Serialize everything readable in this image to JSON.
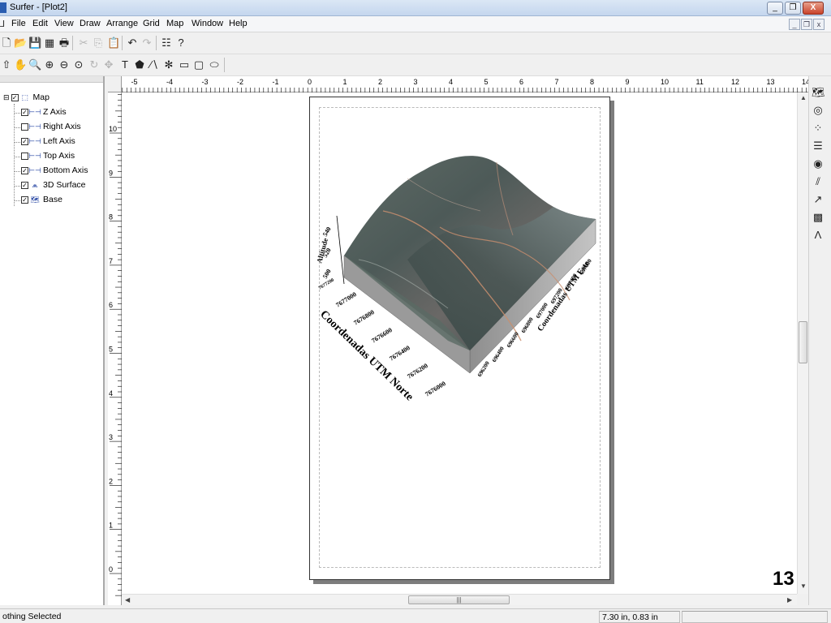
{
  "window": {
    "title": "Surfer - [Plot2]",
    "min": "_",
    "max": "❐",
    "close": "X"
  },
  "mdi_controls": {
    "min": "_",
    "restore": "❐",
    "close": "x"
  },
  "menu": [
    "File",
    "Edit",
    "View",
    "Draw",
    "Arrange",
    "Grid",
    "Map",
    "Window",
    "Help"
  ],
  "toolbar1": [
    {
      "name": "new-icon",
      "glyph": "🗋"
    },
    {
      "name": "open-icon",
      "glyph": "📂"
    },
    {
      "name": "save-icon",
      "glyph": "💾"
    },
    {
      "name": "table-icon",
      "glyph": "▦"
    },
    {
      "name": "print-icon",
      "glyph": "🖶"
    },
    {
      "name": "cut-icon",
      "glyph": "✂",
      "dim": true
    },
    {
      "name": "copy-icon",
      "glyph": "⎘",
      "dim": true
    },
    {
      "name": "paste-icon",
      "glyph": "📋"
    },
    {
      "name": "undo-icon",
      "glyph": "↶"
    },
    {
      "name": "redo-icon",
      "glyph": "↷",
      "dim": true
    },
    {
      "name": "object-manager-icon",
      "glyph": "☷"
    },
    {
      "name": "help-pointer-icon",
      "glyph": "?"
    }
  ],
  "toolbar2": [
    {
      "name": "select-arrow-icon",
      "glyph": "⇧"
    },
    {
      "name": "pan-hand-icon",
      "glyph": "✋"
    },
    {
      "name": "zoom-rect-icon",
      "glyph": "🔍"
    },
    {
      "name": "zoom-in-icon",
      "glyph": "⊕"
    },
    {
      "name": "zoom-out-icon",
      "glyph": "⊖"
    },
    {
      "name": "zoom-fit-icon",
      "glyph": "⊙"
    },
    {
      "name": "rotate-icon",
      "glyph": "↻",
      "dim": true
    },
    {
      "name": "reshape-icon",
      "glyph": "✥",
      "dim": true
    },
    {
      "name": "text-icon",
      "glyph": "T"
    },
    {
      "name": "polygon-icon",
      "glyph": "⬟"
    },
    {
      "name": "polyline-icon",
      "glyph": "∕∖"
    },
    {
      "name": "symbol-icon",
      "glyph": "✻"
    },
    {
      "name": "rectangle-icon",
      "glyph": "▭"
    },
    {
      "name": "rounded-rectangle-icon",
      "glyph": "▢"
    },
    {
      "name": "ellipse-icon",
      "glyph": "⬭"
    }
  ],
  "tree": [
    {
      "label": "Map",
      "checked": true,
      "level": 0,
      "icon": "map-frame-icon",
      "glyph": "⬚"
    },
    {
      "label": "Z Axis",
      "checked": true,
      "level": 1,
      "icon": "axis-icon",
      "glyph": "⊢⊣"
    },
    {
      "label": "Right Axis",
      "checked": false,
      "level": 1,
      "icon": "axis-icon",
      "glyph": "⊢⊣"
    },
    {
      "label": "Left Axis",
      "checked": true,
      "level": 1,
      "icon": "axis-icon",
      "glyph": "⊢⊣"
    },
    {
      "label": "Top Axis",
      "checked": false,
      "level": 1,
      "icon": "axis-icon",
      "glyph": "⊢⊣"
    },
    {
      "label": "Bottom Axis",
      "checked": true,
      "level": 1,
      "icon": "axis-icon",
      "glyph": "⊢⊣"
    },
    {
      "label": "3D Surface",
      "checked": true,
      "level": 1,
      "icon": "surface-icon",
      "glyph": "⩕"
    },
    {
      "label": "Base",
      "checked": true,
      "level": 1,
      "icon": "base-map-icon",
      "glyph": "🗺"
    }
  ],
  "hruler_labels": [
    "-5",
    "-4",
    "-3",
    "-2",
    "-1",
    "0",
    "1",
    "2",
    "3",
    "4",
    "5",
    "6",
    "7",
    "8",
    "9",
    "10",
    "11",
    "12",
    "13",
    "14"
  ],
  "vruler_labels": [
    "10",
    "9",
    "8",
    "7",
    "6",
    "5",
    "4",
    "3",
    "2",
    "1",
    "0"
  ],
  "plot": {
    "z_title": "Altitude",
    "z_ticks": [
      "540",
      "520",
      "500"
    ],
    "left_title": "Coordenadas UTM Norte",
    "left_ticks": [
      "7677200",
      "7677000",
      "7676800",
      "7676600",
      "7676400",
      "7676200",
      "7676000"
    ],
    "bottom_title": "Coordenadas UTM Este",
    "bottom_ticks": [
      "696200",
      "696400",
      "696600",
      "696800",
      "697000",
      "697200",
      "697400",
      "697600"
    ]
  },
  "right_tools": [
    {
      "name": "base-map-tool-icon",
      "glyph": "🗺"
    },
    {
      "name": "contour-map-tool-icon",
      "glyph": "◎"
    },
    {
      "name": "post-map-tool-icon",
      "glyph": "⁘"
    },
    {
      "name": "classed-post-tool-icon",
      "glyph": "☰"
    },
    {
      "name": "image-map-tool-icon",
      "glyph": "◉"
    },
    {
      "name": "shaded-relief-tool-icon",
      "glyph": "⫽"
    },
    {
      "name": "vector-map-tool-icon",
      "glyph": "↗"
    },
    {
      "name": "wireframe-tool-icon",
      "glyph": "▩"
    },
    {
      "name": "surface-tool-icon",
      "glyph": "Λ"
    }
  ],
  "status": {
    "message": "othing Selected",
    "coords": "7.30 in, 0.83 in"
  },
  "slide_number": "13"
}
